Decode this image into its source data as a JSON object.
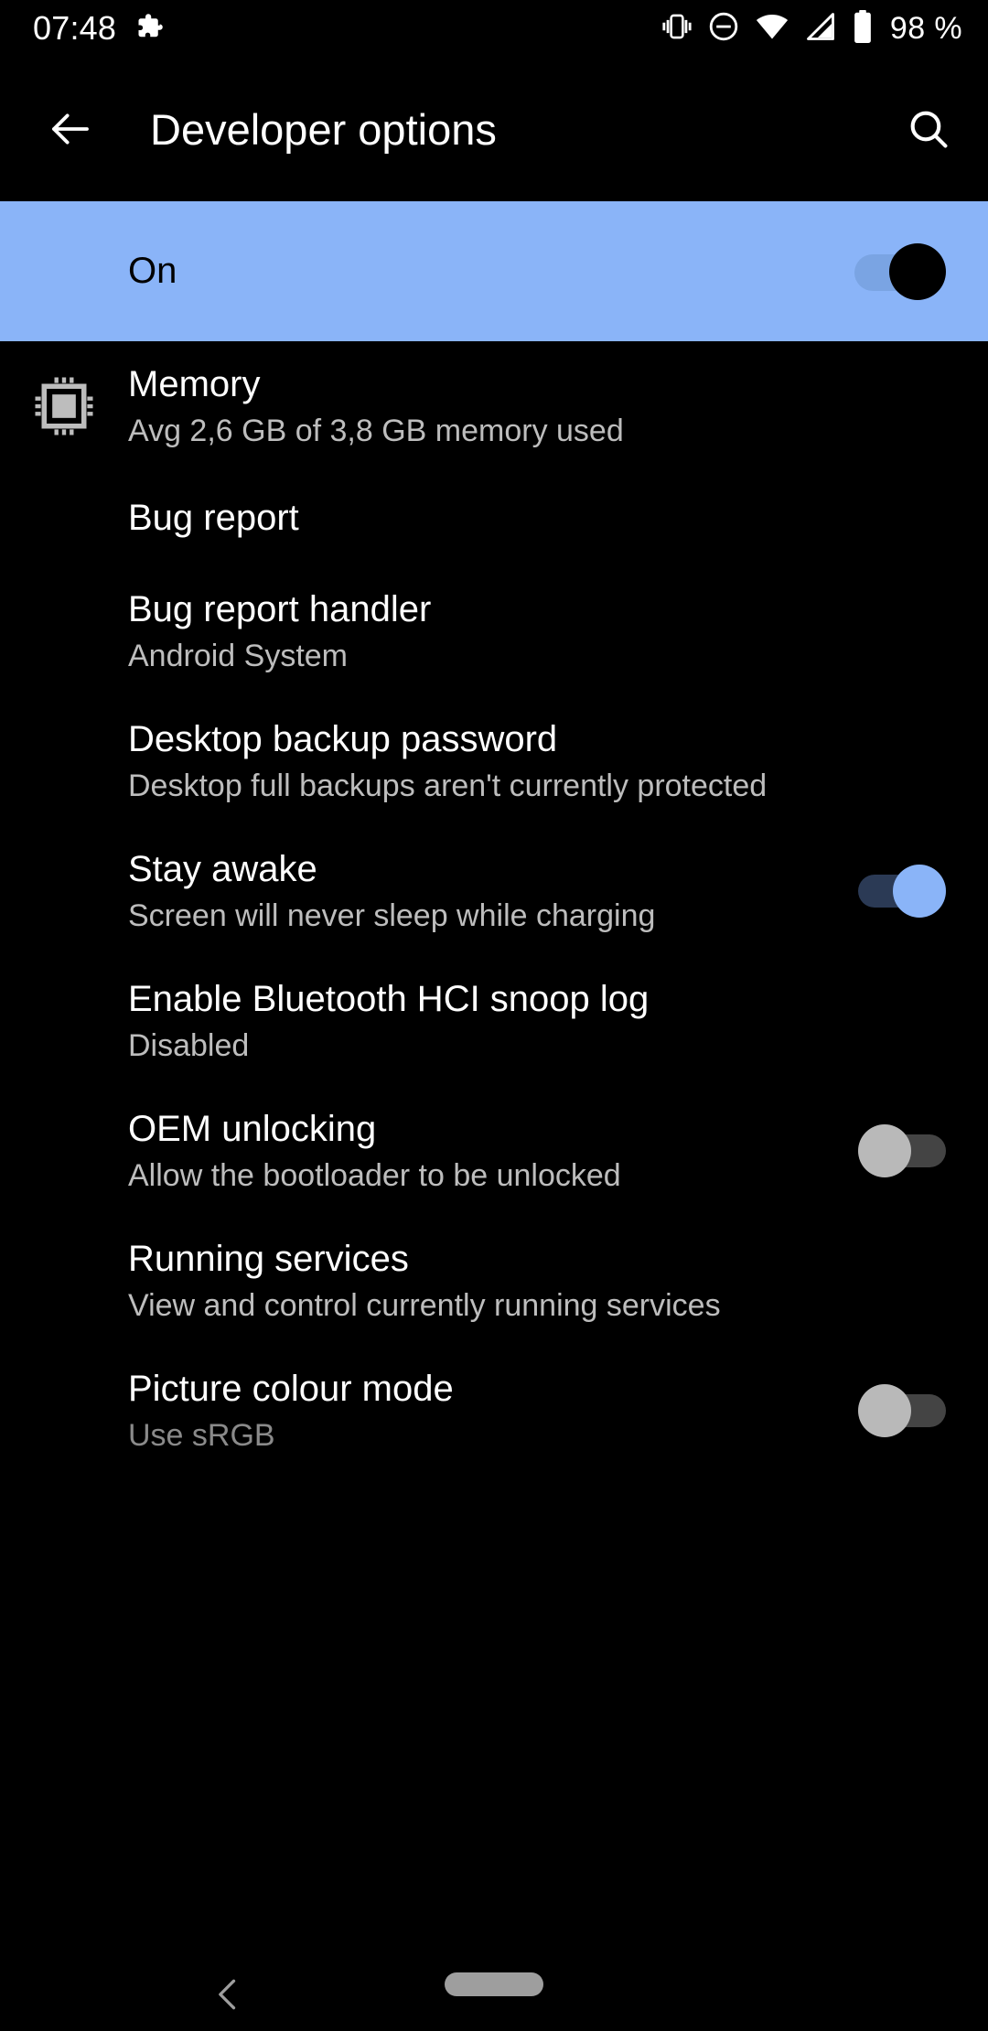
{
  "status_bar": {
    "time": "07:48",
    "battery_percent": "98 %",
    "icons": [
      "puzzle-piece-icon",
      "vibrate-icon",
      "do-not-disturb-icon",
      "wifi-icon",
      "cellular-signal-icon",
      "battery-icon"
    ]
  },
  "app_bar": {
    "title": "Developer options",
    "back_icon": "arrow-back-icon",
    "search_icon": "search-icon"
  },
  "master_switch": {
    "label": "On",
    "state": "on",
    "banner_color": "#8AB4F8",
    "thumb_color": "#000000"
  },
  "settings": [
    {
      "id": "memory",
      "title": "Memory",
      "subtitle": "Avg 2,6 GB of 3,8 GB memory used",
      "icon": "memory-chip-icon",
      "control": "none"
    },
    {
      "id": "bug-report",
      "title": "Bug report",
      "subtitle": "",
      "icon": "",
      "control": "none"
    },
    {
      "id": "bug-report-handler",
      "title": "Bug report handler",
      "subtitle": "Android System",
      "icon": "",
      "control": "none"
    },
    {
      "id": "desktop-backup-password",
      "title": "Desktop backup password",
      "subtitle": "Desktop full backups aren't currently protected",
      "icon": "",
      "control": "none"
    },
    {
      "id": "stay-awake",
      "title": "Stay awake",
      "subtitle": "Screen will never sleep while charging",
      "icon": "",
      "control": "switch",
      "switch_state": "on"
    },
    {
      "id": "bluetooth-hci-snoop-log",
      "title": "Enable Bluetooth HCI snoop log",
      "subtitle": "Disabled",
      "icon": "",
      "control": "none"
    },
    {
      "id": "oem-unlocking",
      "title": "OEM unlocking",
      "subtitle": "Allow the bootloader to be unlocked",
      "icon": "",
      "control": "switch",
      "switch_state": "off"
    },
    {
      "id": "running-services",
      "title": "Running services",
      "subtitle": "View and control currently running services",
      "icon": "",
      "control": "none"
    },
    {
      "id": "picture-colour-mode",
      "title": "Picture colour mode",
      "subtitle": "Use sRGB",
      "icon": "",
      "control": "switch",
      "switch_state": "off"
    }
  ],
  "nav_bar": {
    "back_icon": "chevron-back-icon",
    "home_pill": "home-gesture-pill"
  },
  "colors": {
    "background": "#000000",
    "accent": "#8AB4F8",
    "title_text": "#FFFFFF",
    "subtitle_text": "#BDBDBD"
  }
}
